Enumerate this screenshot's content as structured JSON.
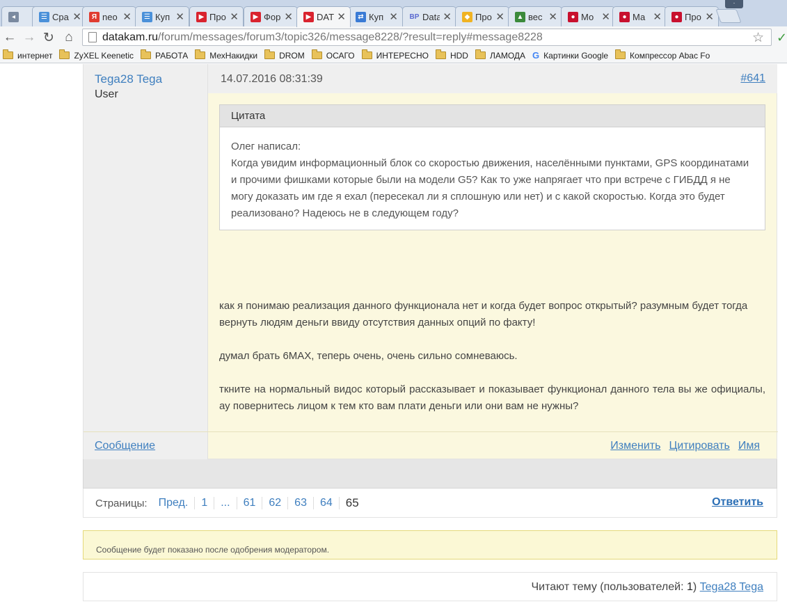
{
  "browser": {
    "tabs": [
      {
        "title": "",
        "icon": "speaker-icon",
        "color": "#7a8aa0"
      },
      {
        "title": "Сра",
        "icon": "cart-icon",
        "color": "#4a90d9"
      },
      {
        "title": "neo",
        "icon": "yandex-icon",
        "color": "#e03c31"
      },
      {
        "title": "Куп",
        "icon": "cart-icon",
        "color": "#4a90d9"
      },
      {
        "title": "Про",
        "icon": "datakam-icon",
        "color": "#d9232e"
      },
      {
        "title": "Фор",
        "icon": "datakam-icon",
        "color": "#d9232e"
      },
      {
        "title": "DAT",
        "icon": "datakam-icon",
        "color": "#d9232e"
      },
      {
        "title": "Куп",
        "icon": "swap-icon",
        "color": "#3a7bd5"
      },
      {
        "title": "Data",
        "icon": "bp-icon",
        "color": "#5b6ad0"
      },
      {
        "title": "Про",
        "icon": "diamond-icon",
        "color": "#f0b323"
      },
      {
        "title": "вес",
        "icon": "image-icon",
        "color": "#3b8a3b"
      },
      {
        "title": "Мо",
        "icon": "drive2-icon",
        "color": "#c8102e"
      },
      {
        "title": "Ма",
        "icon": "drive2-icon",
        "color": "#c8102e"
      },
      {
        "title": "Про",
        "icon": "drive2-icon",
        "color": "#c8102e"
      }
    ],
    "url_host": "datakam.ru",
    "url_path": "/forum/messages/forum3/topic326/message8228/?result=reply#message8228",
    "bookmarks": [
      {
        "label": "интернет",
        "type": "folder"
      },
      {
        "label": "ZyXEL Keenetic",
        "type": "folder"
      },
      {
        "label": "РАБОТА",
        "type": "folder"
      },
      {
        "label": "МехНакидки",
        "type": "folder"
      },
      {
        "label": "DROM",
        "type": "folder"
      },
      {
        "label": "ОСАГО",
        "type": "folder"
      },
      {
        "label": "ИНТЕРЕСНО",
        "type": "folder"
      },
      {
        "label": "HDD",
        "type": "folder"
      },
      {
        "label": "ЛАМОДА",
        "type": "folder"
      },
      {
        "label": "Картинки Google",
        "type": "google"
      },
      {
        "label": "Компрессор Abac Fo",
        "type": "folder"
      }
    ]
  },
  "post": {
    "author_name": "Tega28 Tega",
    "author_role": "User",
    "date": "14.07.2016 08:31:39",
    "number": "#641",
    "quote_title": "Цитата",
    "quote_author": "Олег написал:",
    "quote_text": "Когда увидим информационный блок со скоростью движения, населёнными пунктами, GPS координатами и прочими фишками которые были на модели G5? Как то уже напрягает что при встрече с ГИБДД я не могу доказать им где я ехал (пересекал ли я сплошную или нет) и с какой скоростью. Когда это будет реализовано? Надеюсь не в следующем году?",
    "paragraphs": [
      "как я понимаю реализация данного функционала нет и когда будет вопрос открытый? разумным будет тогда вернуть людям деньги ввиду отсутствия данных опций по факту!",
      "думал брать 6MAX, теперь очень, очень сильно сомневаюсь.",
      "ткните на нормальный видос который рассказывает и показывает функционал данного тела вы же официалы, ау повернитесь лицом к тем кто вам плати деньги или они вам не нужны?"
    ],
    "footer_message_link": "Сообщение",
    "footer_actions": [
      "Изменить",
      "Цитировать",
      "Имя"
    ]
  },
  "pager": {
    "label": "Страницы:",
    "prev": "Пред.",
    "pages": [
      "1",
      "...",
      "61",
      "62",
      "63",
      "64"
    ],
    "current": "65",
    "reply": "Ответить"
  },
  "notice": "Сообщение будет показано после одобрения модератором.",
  "readers": {
    "prefix": "Читают тему (пользователей: ",
    "count": "1",
    "suffix": ") ",
    "user": "Tega28 Tega"
  }
}
